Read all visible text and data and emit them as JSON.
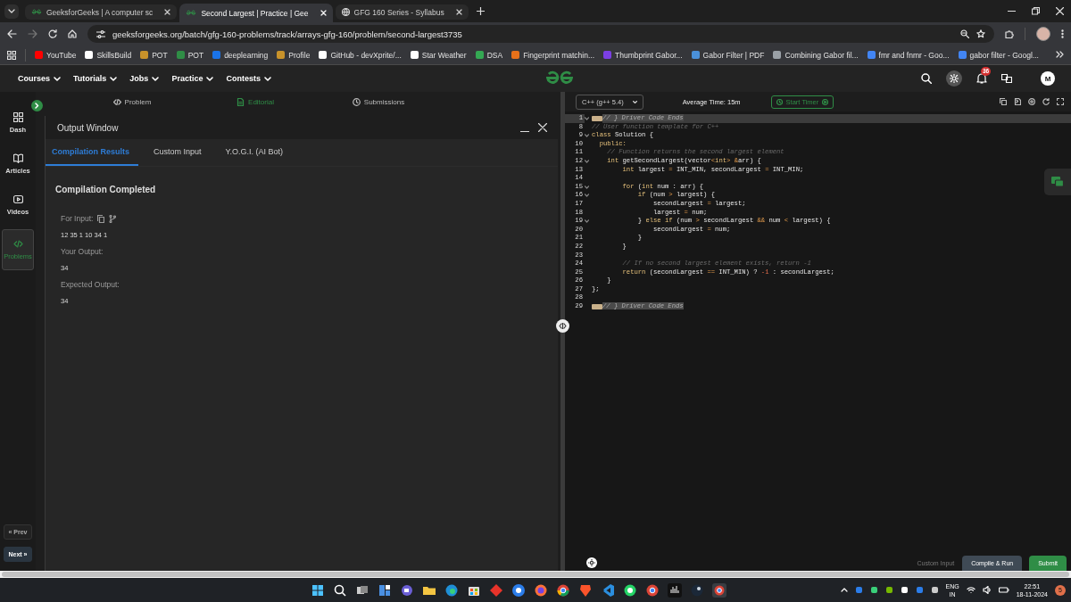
{
  "browser": {
    "tabs": [
      {
        "title": "GeeksforGeeks | A computer sc",
        "selected": false
      },
      {
        "title": "Second Largest | Practice | Gee",
        "selected": true
      },
      {
        "title": "GFG 160 Series - Syllabus",
        "selected": false
      }
    ],
    "url": "geeksforgeeks.org/batch/gfg-160-problems/track/arrays-gfg-160/problem/second-largest3735",
    "bookmarks": [
      {
        "label": "YouTube"
      },
      {
        "label": "SkillsBuild"
      },
      {
        "label": "POT"
      },
      {
        "label": "POT"
      },
      {
        "label": "deeplearning"
      },
      {
        "label": "Profile"
      },
      {
        "label": "GitHub - devXprite/..."
      },
      {
        "label": "Star Weather"
      },
      {
        "label": "DSA"
      },
      {
        "label": "Fingerprint matchin..."
      },
      {
        "label": "Thumbprint Gabor..."
      },
      {
        "label": "Gabor Filter | PDF"
      },
      {
        "label": "Combining Gabor fil..."
      },
      {
        "label": "fmr and fnmr - Goo..."
      },
      {
        "label": "gabor filter - Googl..."
      }
    ]
  },
  "nav": {
    "menu": [
      {
        "label": "Courses"
      },
      {
        "label": "Tutorials"
      },
      {
        "label": "Jobs"
      },
      {
        "label": "Practice"
      },
      {
        "label": "Contests"
      }
    ],
    "notification_count": "36",
    "avatar": "M"
  },
  "sidebar": {
    "items": [
      {
        "label": "Dash",
        "selected": false
      },
      {
        "label": "Articles",
        "selected": false
      },
      {
        "label": "Videos",
        "selected": false
      },
      {
        "label": "Problems",
        "selected": true
      }
    ],
    "prev": "« Prev",
    "next": "Next »"
  },
  "problem_tabs": [
    {
      "label": "Problem",
      "selected": false
    },
    {
      "label": "Editorial",
      "selected": true
    },
    {
      "label": "Submissions",
      "selected": false
    }
  ],
  "output_window": {
    "title": "Output Window",
    "tabs": [
      {
        "label": "Compilation Results",
        "selected": true
      },
      {
        "label": "Custom Input",
        "selected": false
      },
      {
        "label": "Y.O.G.I. (AI Bot)",
        "selected": false
      }
    ],
    "status": "Compilation Completed",
    "fields": [
      {
        "kind": "input",
        "label": "For Input:",
        "value": "12 35 1 10 34 1"
      },
      {
        "kind": "output",
        "label": "Your Output:",
        "value": "34"
      },
      {
        "kind": "output",
        "label": "Expected Output:",
        "value": "34"
      }
    ]
  },
  "editor": {
    "language": "C++ (g++ 5.4)",
    "average_time": "Average Time: 15m",
    "timer_button": "Start Timer",
    "lines": [
      {
        "number": "1",
        "foldable": true,
        "folded": true,
        "active": true,
        "segments": [
          {
            "kind": "comment",
            "text": "// } Driver Code Ends"
          }
        ]
      },
      {
        "number": "8",
        "foldable": false,
        "folded": false,
        "active": false,
        "segments": [
          {
            "kind": "comment",
            "text": "// User function template for C++"
          }
        ]
      },
      {
        "number": "9",
        "foldable": true,
        "folded": false,
        "active": false,
        "segments": [
          {
            "kind": "keyword",
            "text": "class"
          },
          {
            "kind": "plain",
            "text": " Solution {"
          }
        ]
      },
      {
        "number": "10",
        "foldable": false,
        "folded": false,
        "active": false,
        "segments": [
          {
            "kind": "keyword",
            "text": "  public:"
          }
        ]
      },
      {
        "number": "11",
        "foldable": false,
        "folded": false,
        "active": false,
        "segments": [
          {
            "kind": "comment",
            "text": "    // Function returns the second largest element"
          }
        ]
      },
      {
        "number": "12",
        "foldable": true,
        "folded": false,
        "active": false,
        "segments": [
          {
            "kind": "keyword",
            "text": "    int"
          },
          {
            "kind": "plain",
            "text": " getSecondLargest(vector"
          },
          {
            "kind": "operator",
            "text": "<"
          },
          {
            "kind": "keyword",
            "text": "int"
          },
          {
            "kind": "operator",
            "text": ">"
          },
          {
            "kind": "operator",
            "text": " &"
          },
          {
            "kind": "plain",
            "text": "arr) {"
          }
        ]
      },
      {
        "number": "13",
        "foldable": false,
        "folded": false,
        "active": false,
        "segments": [
          {
            "kind": "keyword",
            "text": "        int"
          },
          {
            "kind": "plain",
            "text": " largest "
          },
          {
            "kind": "operator",
            "text": "="
          },
          {
            "kind": "plain",
            "text": " INT_MIN, secondLargest "
          },
          {
            "kind": "operator",
            "text": "="
          },
          {
            "kind": "plain",
            "text": " INT_MIN;"
          }
        ]
      },
      {
        "number": "14",
        "foldable": false,
        "folded": false,
        "active": false
      },
      {
        "number": "15",
        "foldable": true,
        "folded": false,
        "active": false,
        "segments": [
          {
            "kind": "keyword",
            "text": "        for"
          },
          {
            "kind": "plain",
            "text": " ("
          },
          {
            "kind": "keyword",
            "text": "int"
          },
          {
            "kind": "plain",
            "text": " num : arr) {"
          }
        ]
      },
      {
        "number": "16",
        "foldable": true,
        "folded": false,
        "active": false,
        "segments": [
          {
            "kind": "keyword",
            "text": "            if"
          },
          {
            "kind": "plain",
            "text": " (num "
          },
          {
            "kind": "operator",
            "text": ">"
          },
          {
            "kind": "plain",
            "text": " largest) {"
          }
        ]
      },
      {
        "number": "17",
        "foldable": false,
        "folded": false,
        "active": false,
        "segments": [
          {
            "kind": "plain",
            "text": "                secondLargest "
          },
          {
            "kind": "operator",
            "text": "="
          },
          {
            "kind": "plain",
            "text": " largest;"
          }
        ]
      },
      {
        "number": "18",
        "foldable": false,
        "folded": false,
        "active": false,
        "segments": [
          {
            "kind": "plain",
            "text": "                largest "
          },
          {
            "kind": "operator",
            "text": "="
          },
          {
            "kind": "plain",
            "text": " num;"
          }
        ]
      },
      {
        "number": "19",
        "foldable": true,
        "folded": false,
        "active": false,
        "segments": [
          {
            "kind": "plain",
            "text": "            } "
          },
          {
            "kind": "keyword",
            "text": "else if"
          },
          {
            "kind": "plain",
            "text": " (num "
          },
          {
            "kind": "operator",
            "text": ">"
          },
          {
            "kind": "plain",
            "text": " secondLargest "
          },
          {
            "kind": "operator",
            "text": "&&"
          },
          {
            "kind": "plain",
            "text": " num "
          },
          {
            "kind": "operator",
            "text": "<"
          },
          {
            "kind": "plain",
            "text": " largest) {"
          }
        ]
      },
      {
        "number": "20",
        "foldable": false,
        "folded": false,
        "active": false,
        "segments": [
          {
            "kind": "plain",
            "text": "                secondLargest "
          },
          {
            "kind": "operator",
            "text": "="
          },
          {
            "kind": "plain",
            "text": " num;"
          }
        ]
      },
      {
        "number": "21",
        "foldable": false,
        "folded": false,
        "active": false,
        "segments": [
          {
            "kind": "plain",
            "text": "            }"
          }
        ]
      },
      {
        "number": "22",
        "foldable": false,
        "folded": false,
        "active": false,
        "segments": [
          {
            "kind": "plain",
            "text": "        }"
          }
        ]
      },
      {
        "number": "23",
        "foldable": false,
        "folded": false,
        "active": false
      },
      {
        "number": "24",
        "foldable": false,
        "folded": false,
        "active": false,
        "segments": [
          {
            "kind": "comment",
            "text": "        // If no second largest element exists, return -1"
          }
        ]
      },
      {
        "number": "25",
        "foldable": false,
        "folded": false,
        "active": false,
        "segments": [
          {
            "kind": "keyword",
            "text": "        return"
          },
          {
            "kind": "plain",
            "text": " (secondLargest "
          },
          {
            "kind": "operator",
            "text": "=="
          },
          {
            "kind": "plain",
            "text": " INT_MIN) ? "
          },
          {
            "kind": "number",
            "text": "-1"
          },
          {
            "kind": "plain",
            "text": " : secondLargest;"
          }
        ]
      },
      {
        "number": "26",
        "foldable": false,
        "folded": false,
        "active": false,
        "segments": [
          {
            "kind": "plain",
            "text": "    }"
          }
        ]
      },
      {
        "number": "27",
        "foldable": false,
        "folded": false,
        "active": false,
        "segments": [
          {
            "kind": "plain",
            "text": "};"
          }
        ]
      },
      {
        "number": "28",
        "foldable": false,
        "folded": false,
        "active": false
      },
      {
        "number": "29",
        "foldable": false,
        "folded": true,
        "active": false,
        "segments": [
          {
            "kind": "comment",
            "text": "// } Driver Code Ends"
          }
        ]
      }
    ],
    "custom_input": "Custom Input",
    "compile_button": "Compile & Run",
    "submit_button": "Submit"
  },
  "taskbar": {
    "language": "ENG",
    "region": "IN",
    "time": "22:51",
    "date": "18-11-2024",
    "notification_count": "5"
  }
}
